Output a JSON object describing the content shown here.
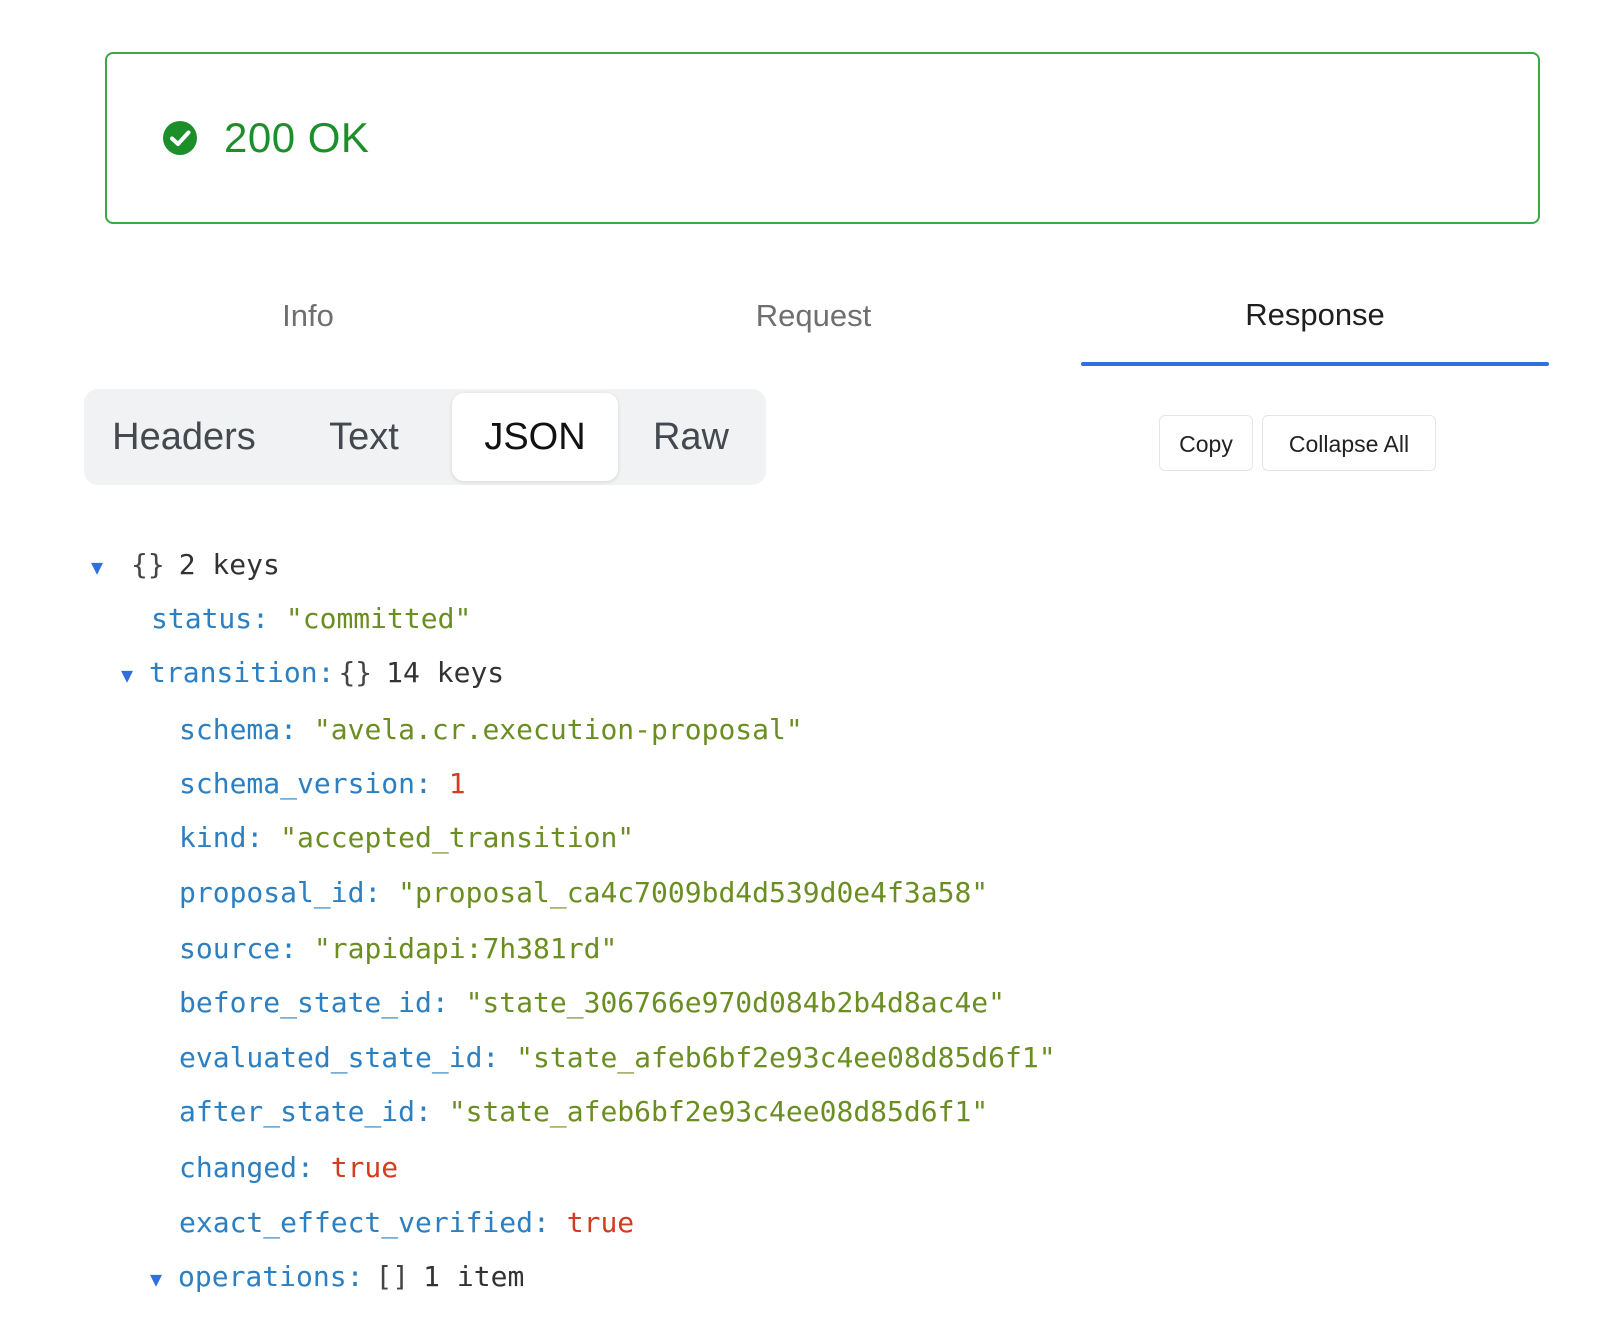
{
  "status": {
    "icon": "check-circle-icon",
    "text": "200 OK",
    "color": "#1c8f2a",
    "border_color": "#39a845"
  },
  "main_tabs": [
    {
      "label": "Info"
    },
    {
      "label": "Request"
    },
    {
      "label": "Response"
    }
  ],
  "active_main_tab": "Response",
  "view_tabs": [
    {
      "label": "Headers"
    },
    {
      "label": "Text"
    },
    {
      "label": "JSON"
    },
    {
      "label": "Raw"
    }
  ],
  "active_view_tab": "JSON",
  "actions": {
    "copy_label": "Copy",
    "collapse_label": "Collapse All"
  },
  "json_tree": {
    "root_brace": "{}",
    "root_count": "2 keys",
    "status_key": "status:",
    "status_value": "\"committed\"",
    "transition_key": "transition:",
    "transition_brace": "{}",
    "transition_count": "14 keys",
    "fields": [
      {
        "key": "schema:",
        "value": "\"avela.cr.execution-proposal\"",
        "type": "string"
      },
      {
        "key": "schema_version:",
        "value": "1",
        "type": "number"
      },
      {
        "key": "kind:",
        "value": "\"accepted_transition\"",
        "type": "string"
      },
      {
        "key": "proposal_id:",
        "value": "\"proposal_ca4c7009bd4d539d0e4f3a58\"",
        "type": "string"
      },
      {
        "key": "source:",
        "value": "\"rapidapi:7h381rd\"",
        "type": "string"
      },
      {
        "key": "before_state_id:",
        "value": "\"state_306766e970d084b2b4d8ac4e\"",
        "type": "string"
      },
      {
        "key": "evaluated_state_id:",
        "value": "\"state_afeb6bf2e93c4ee08d85d6f1\"",
        "type": "string"
      },
      {
        "key": "after_state_id:",
        "value": "\"state_afeb6bf2e93c4ee08d85d6f1\"",
        "type": "string"
      },
      {
        "key": "changed:",
        "value": "true",
        "type": "bool"
      },
      {
        "key": "exact_effect_verified:",
        "value": "true",
        "type": "bool"
      }
    ],
    "operations_key": "operations:",
    "operations_brace": "[]",
    "operations_count": "1 item"
  },
  "colors": {
    "accent": "#2f6fe0",
    "key": "#2c7fc0",
    "string": "#6b8e23",
    "number_bool": "#d23c1f"
  }
}
